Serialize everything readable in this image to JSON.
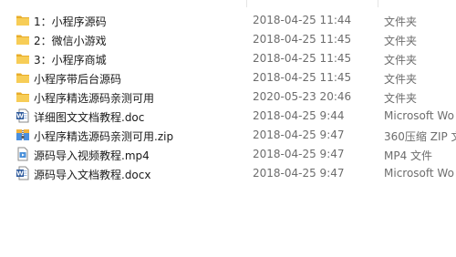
{
  "files": [
    {
      "name": "1：小程序源码",
      "date": "2018-04-25 11:44",
      "type": "文件夹",
      "icon": "folder-icon"
    },
    {
      "name": "2：微信小游戏",
      "date": "2018-04-25 11:45",
      "type": "文件夹",
      "icon": "folder-icon"
    },
    {
      "name": "3：小程序商城",
      "date": "2018-04-25 11:45",
      "type": "文件夹",
      "icon": "folder-icon"
    },
    {
      "name": "小程序带后台源码",
      "date": "2018-04-25 11:45",
      "type": "文件夹",
      "icon": "folder-icon"
    },
    {
      "name": "小程序精选源码亲测可用",
      "date": "2020-05-23 20:46",
      "type": "文件夹",
      "icon": "folder-icon"
    },
    {
      "name": "详细图文文档教程.doc",
      "date": "2018-04-25 9:44",
      "type": "Microsoft Wo",
      "icon": "word-doc-icon"
    },
    {
      "name": "小程序精选源码亲测可用.zip",
      "date": "2018-04-25 9:47",
      "type": "360压缩 ZIP 文",
      "icon": "zip-archive-icon"
    },
    {
      "name": "源码导入视频教程.mp4",
      "date": "2018-04-25 9:47",
      "type": "MP4 文件",
      "icon": "video-file-icon"
    },
    {
      "name": "源码导入文档教程.docx",
      "date": "2018-04-25 9:47",
      "type": "Microsoft Wo",
      "icon": "word-doc-icon"
    }
  ],
  "colors": {
    "folder": "#f5c242",
    "word": "#2b579a",
    "zip": "#3a7fd5",
    "video": "#4a90d9",
    "secondary_text": "#6d6d6d"
  }
}
